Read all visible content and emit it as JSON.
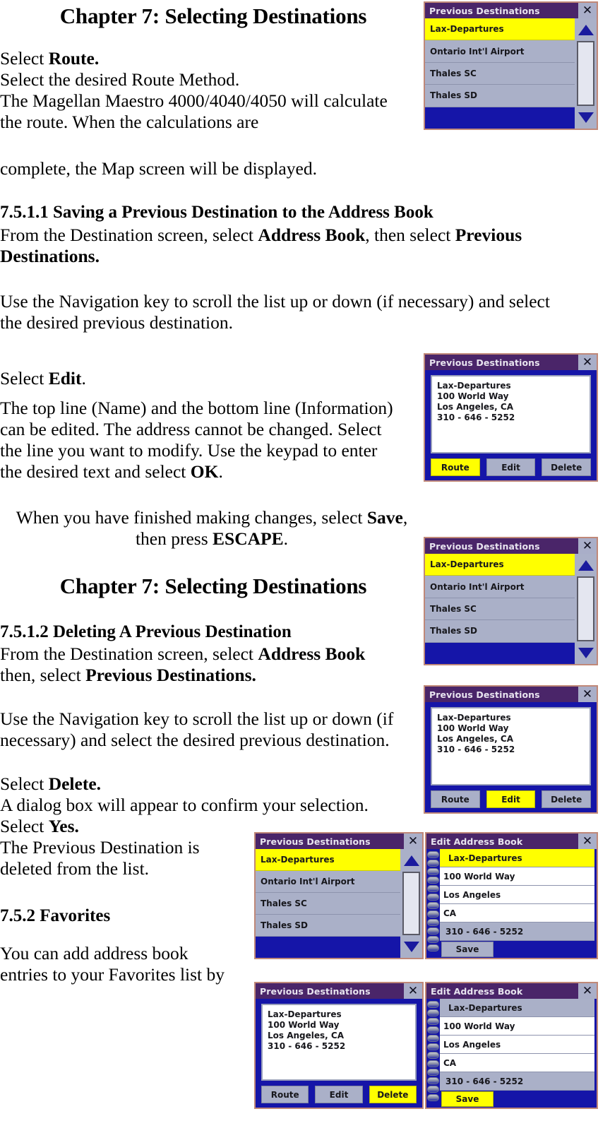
{
  "document": {
    "chapter_title_1": "Chapter 7: Selecting Destinations",
    "chapter_title_2": "Chapter 7: Selecting Destinations",
    "p1_line1_a": "Select ",
    "p1_line1_b": "Route.",
    "p1_line2": "Select the desired Route Method.",
    "p1_line3": "The Magellan Maestro 4000/4040/4050 will calculate",
    "p1_line4": "the route. When the calculations are",
    "p2": "complete, the Map screen will be displayed.",
    "h_7511": "7.5.1.1 Saving a Previous Destination to the Address Book",
    "p3_a": "From the Destination screen, select ",
    "p3_b": "Address Book",
    "p3_c": ", then select ",
    "p3_d": "Previous",
    "p3_e": "Destinations.",
    "p4": "Use the Navigation key to scroll the list up or down (if necessary) and select",
    "p4_line2": "the desired previous destination.",
    "p5_a": "Select ",
    "p5_b": "Edit",
    "p5_c": ".",
    "p6_line1": "The top line (Name) and the bottom line (Information)",
    "p6_line2": "can be edited. The address cannot be changed. Select",
    "p6_line3": "the line you want to modify. Use the keypad to enter",
    "p6_line4_a": "the desired text and select ",
    "p6_line4_b": "OK",
    "p6_line4_c": ".",
    "p7_line1_a": "When you have finished making changes, select ",
    "p7_line1_b": "Save",
    "p7_line1_c": ",",
    "p7_line2_a": "then press ",
    "p7_line2_b": "ESCAPE",
    "p7_line2_c": ".",
    "h_7512": "7.5.1.2 Deleting A Previous Destination",
    "p8_a": "From the Destination screen, select ",
    "p8_b": "Address Book",
    "p8_line2_a": "then, select ",
    "p8_line2_b": "Previous Destinations.",
    "p9_line1": "Use the Navigation key to scroll the list up or down (if",
    "p9_line2": "necessary) and select the desired previous destination.",
    "p10_a": "Select ",
    "p10_b": "Delete.",
    "p11": "A dialog box will appear to confirm your selection.",
    "p12_a": "Select ",
    "p12_b": "Yes.",
    "p13_line1": "The Previous Destination is",
    "p13_line2": "deleted from the list.",
    "h_752": "7.5.2 Favorites",
    "p14_line1": "You can add address book",
    "p14_line2": "entries to your Favorites list by"
  },
  "screens": {
    "prev_dest_title": "Previous Destinations",
    "edit_addr_title": "Edit Address Book",
    "close_glyph": "✕",
    "list_items": [
      "Lax-Departures",
      "Ontario Int'l Airport",
      "Thales SC",
      "Thales SD"
    ],
    "detail_lines": [
      "Lax-Departures",
      "100 World Way",
      "Los Angeles, CA",
      "310 - 646 - 5252"
    ],
    "buttons": {
      "route": "Route",
      "edit": "Edit",
      "delete": "Delete",
      "save": "Save"
    },
    "edit_fields": [
      "Lax-Departures",
      "100 World Way",
      "Los Angeles",
      "CA",
      "310 - 646 - 5252"
    ]
  },
  "colors": {
    "titlebar": "#4a2569",
    "body_blue": "#1515a8",
    "row_gray": "#aab0c8",
    "highlight_yellow": "#ffff00",
    "frame": "#c08878"
  }
}
